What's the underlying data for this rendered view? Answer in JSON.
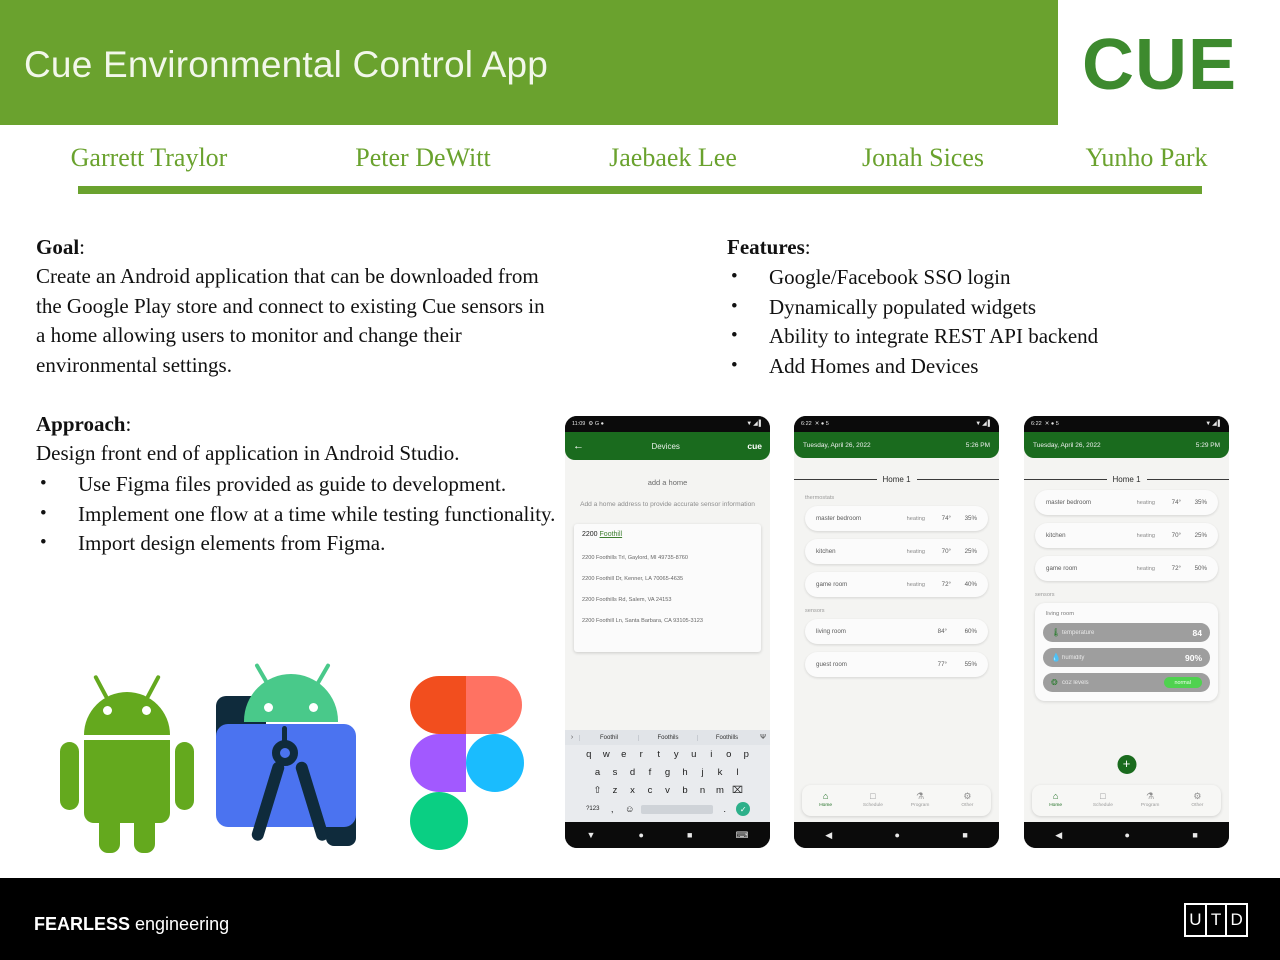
{
  "header": {
    "title": "Cue Environmental Control App",
    "logo": "CUE",
    "band_color": "#6aa22e",
    "logo_color": "#3d8a2e"
  },
  "authors": [
    "Garrett Traylor",
    "Peter DeWitt",
    "Jaebaek Lee",
    "Jonah Sices",
    "Yunho Park"
  ],
  "goal": {
    "heading": "Goal",
    "colon": ":",
    "body": "Create an Android application that can be downloaded from the Google Play store and connect to existing Cue sensors in a home allowing users to monitor and change their environmental settings."
  },
  "approach": {
    "heading": "Approach",
    "colon": ":",
    "body": "Design front end of application in Android Studio.",
    "bullets": [
      "Use Figma files provided as guide to development.",
      "Implement one flow at a time while testing functionality.",
      "Import design elements from Figma."
    ]
  },
  "features": {
    "heading": "Features",
    "colon": ":",
    "bullets": [
      "Google/Facebook SSO login",
      "Dynamically populated widgets",
      "Ability to integrate REST API backend",
      "Add Homes and Devices"
    ]
  },
  "logos": [
    {
      "name": "android-logo"
    },
    {
      "name": "android-studio-logo"
    },
    {
      "name": "figma-logo"
    }
  ],
  "phone1": {
    "status_left": "11:09",
    "status_icons": "⚙ G ●",
    "status_right": "▼◢▌",
    "appbar": {
      "back": "←",
      "title": "Devices",
      "brand": "cue"
    },
    "add_home_title": "add a home",
    "add_home_sub": "Add a home address to provide accurate sensor information",
    "query_prefix": "2200 ",
    "query_underline": "Foothill",
    "suggestions": [
      "2200 Foothills Trl, Gaylord, MI 49735-8760",
      "2200 Foothill Dr, Kenner, LA 70065-4635",
      "2200 Foothills Rd, Salem, VA 24153",
      "2200 Foothill Ln, Santa Barbara, CA 93105-3123"
    ],
    "keyboard": {
      "chev": "›",
      "sugg": [
        "Foothil",
        "Foothils",
        "Foothills"
      ],
      "mic": "Ψ",
      "row1": [
        "q",
        "w",
        "e",
        "r",
        "t",
        "y",
        "u",
        "i",
        "o",
        "p"
      ],
      "row2": [
        "a",
        "s",
        "d",
        "f",
        "g",
        "h",
        "j",
        "k",
        "l"
      ],
      "row3_shift": "⇧",
      "row3": [
        "z",
        "x",
        "c",
        "v",
        "b",
        "n",
        "m"
      ],
      "row3_del": "⌧",
      "numkey": "?123",
      "comma": ",",
      "emoji": "☺",
      "period": ".",
      "go": "✓"
    },
    "nav": [
      "▼",
      "●",
      "■",
      "⌨"
    ]
  },
  "phone2": {
    "status_left": "6:22",
    "status_icons": "✕ ● 5",
    "status_right": "▼◢▌",
    "date": "Tuesday, April 26, 2022",
    "time": "5:26 PM",
    "home_name": "Home 1",
    "thermostats_label": "thermostats",
    "thermostats": [
      {
        "name": "master bedroom",
        "mode": "heating",
        "temp": "74°",
        "humidity": "35%"
      },
      {
        "name": "kitchen",
        "mode": "heating",
        "temp": "70°",
        "humidity": "25%"
      },
      {
        "name": "game room",
        "mode": "heating",
        "temp": "72°",
        "humidity": "40%"
      }
    ],
    "sensors_label": "sensors",
    "sensors": [
      {
        "name": "living room",
        "temp": "84°",
        "humidity": "60%"
      },
      {
        "name": "guest room",
        "temp": "77°",
        "humidity": "55%"
      }
    ],
    "nav": [
      {
        "icon": "⌂",
        "label": "Home",
        "active": true
      },
      {
        "icon": "□",
        "label": "Schedule",
        "active": false
      },
      {
        "icon": "⚗",
        "label": "Program",
        "active": false
      },
      {
        "icon": "⚙",
        "label": "Other",
        "active": false
      }
    ]
  },
  "phone3": {
    "status_left": "6:22",
    "status_icons": "✕ ● 5",
    "status_right": "▼◢▌",
    "date": "Tuesday, April 26, 2022",
    "time": "5:29 PM",
    "home_name": "Home 1",
    "thermostats": [
      {
        "name": "master bedroom",
        "mode": "heating",
        "temp": "74°",
        "humidity": "35%"
      },
      {
        "name": "kitchen",
        "mode": "heating",
        "temp": "70°",
        "humidity": "25%"
      },
      {
        "name": "game room",
        "mode": "heating",
        "temp": "72°",
        "humidity": "50%"
      }
    ],
    "sensors_label": "sensors",
    "card_title": "living room",
    "devices": [
      {
        "icon": "🌡",
        "name": "temperature",
        "value": "84"
      },
      {
        "icon": "💧",
        "name": "humidity",
        "value": "90%"
      },
      {
        "icon": "❂",
        "name": "co2 levels",
        "badge": "normal"
      }
    ],
    "fab": "+",
    "nav": [
      {
        "icon": "⌂",
        "label": "Home",
        "active": true
      },
      {
        "icon": "□",
        "label": "Schedule",
        "active": false
      },
      {
        "icon": "⚗",
        "label": "Program",
        "active": false
      },
      {
        "icon": "⚙",
        "label": "Other",
        "active": false
      }
    ]
  },
  "footer": {
    "bold": "FEARLESS",
    "light": " engineering",
    "utd": [
      "U",
      "T",
      "D"
    ]
  }
}
